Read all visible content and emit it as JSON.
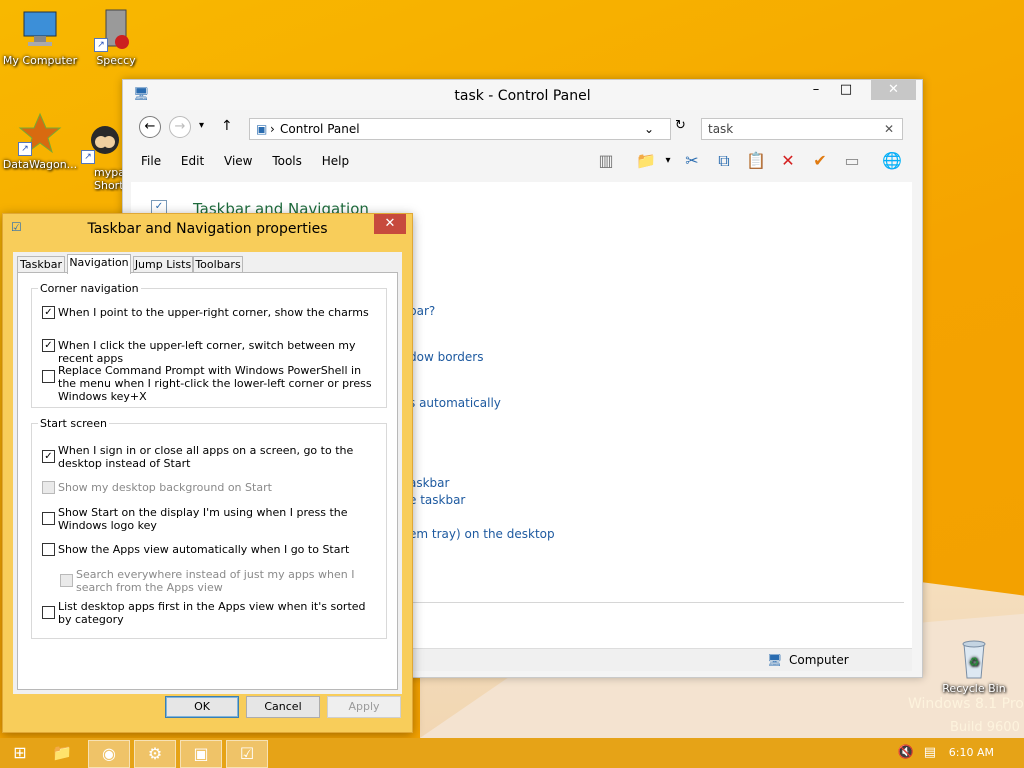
{
  "desktop": {
    "icons": [
      {
        "label": "My Computer"
      },
      {
        "label": "Speccy"
      },
      {
        "label": "DataWagon..."
      },
      {
        "label": "mypa\nShort"
      },
      {
        "label": "Recycle Bin"
      }
    ],
    "watermark_line1": "Windows 8.1 Pro",
    "watermark_line2": "Build 9600"
  },
  "control_panel": {
    "title": "task - Control Panel",
    "address": "Control Panel",
    "search_value": "task",
    "menu": [
      "File",
      "Edit",
      "View",
      "Tools",
      "Help"
    ],
    "heading": "Taskbar and Navigation",
    "links": [
      "bar?",
      "dow borders",
      "s automatically",
      "askbar",
      "e taskbar",
      "em tray) on the desktop"
    ],
    "status": "Computer"
  },
  "dialog": {
    "title": "Taskbar and Navigation properties",
    "tabs": [
      "Taskbar",
      "Navigation",
      "Jump Lists",
      "Toolbars"
    ],
    "group1_title": "Corner navigation",
    "group1": [
      {
        "label": "When I point to the upper-right corner, show the charms",
        "checked": true
      },
      {
        "label": "When I click the upper-left corner, switch between my recent apps",
        "checked": true
      },
      {
        "label": "Replace Command Prompt with Windows PowerShell in the menu when I right-click the lower-left corner or press Windows key+X",
        "checked": false
      }
    ],
    "group2_title": "Start screen",
    "group2": [
      {
        "label": "When I sign in or close all apps on a screen, go to the desktop instead of Start",
        "checked": true
      },
      {
        "label": "Show my desktop background on Start",
        "checked": false,
        "disabled": true
      },
      {
        "label": "Show Start on the display I'm using when I press the Windows logo key",
        "checked": false
      },
      {
        "label": "Show the Apps view automatically when I go to Start",
        "checked": false
      },
      {
        "label": "Search everywhere instead of just my apps when I search from the Apps view",
        "checked": false,
        "disabled": true
      },
      {
        "label": "List desktop apps first in the Apps view when it's sorted by category",
        "checked": false
      }
    ],
    "buttons": {
      "ok": "OK",
      "cancel": "Cancel",
      "apply": "Apply"
    }
  },
  "taskbar": {
    "clock": "6:10 AM"
  },
  "colors": {
    "accent": "#f6a800",
    "link": "#1e5aa0",
    "heading": "#1e6b3c"
  }
}
